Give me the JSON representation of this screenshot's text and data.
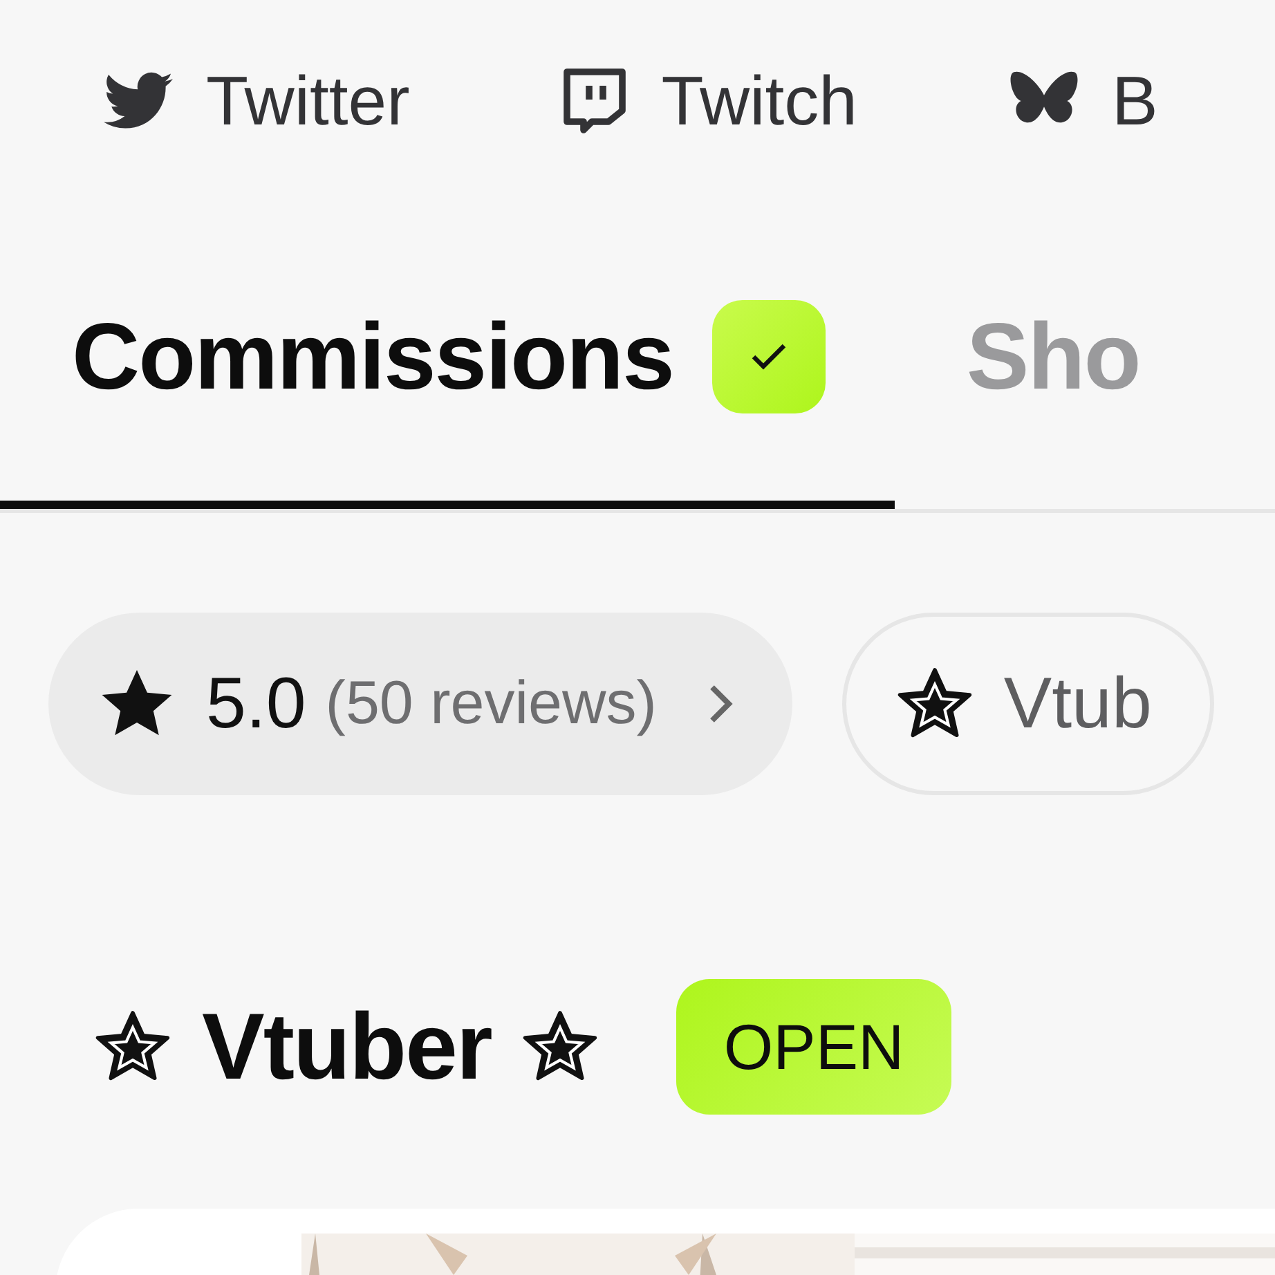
{
  "social_links": [
    {
      "kind": "twitter",
      "label": "Twitter"
    },
    {
      "kind": "twitch",
      "label": "Twitch"
    },
    {
      "kind": "butterfly",
      "label": "B"
    }
  ],
  "tabs": [
    {
      "label": "Commissions",
      "selected": true,
      "verified": true
    },
    {
      "label": "Sho",
      "selected": false,
      "verified": false
    }
  ],
  "chips": [
    {
      "kind": "rating",
      "value": "5.0",
      "count": "(50 reviews)"
    },
    {
      "kind": "category",
      "label": "Vtub"
    }
  ],
  "section": {
    "title": "Vtuber",
    "status": "OPEN"
  }
}
